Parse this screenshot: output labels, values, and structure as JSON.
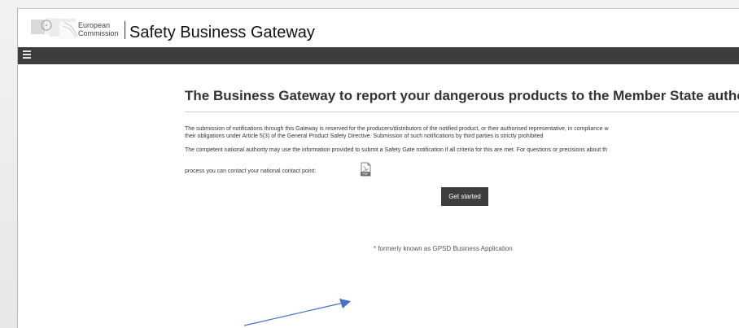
{
  "header": {
    "organization_line1": "European",
    "organization_line2": "Commission",
    "app_title": "Safety Business Gateway"
  },
  "nav": {
    "menu_icon": "hamburger-menu-icon"
  },
  "main": {
    "title": "The Business Gateway to report your dangerous products to the Member State authorities.*",
    "paragraph_1_line_1": "The submission of notifications through this Gateway is reserved for the producers/distributors of the notified product, or their authorised representative, in compliance w",
    "paragraph_1_line_2": "their obligations under Article 5(3) of the General Product Safety Directive. Submission of such notifications by third parties is strictly prohibited",
    "paragraph_2_line_1": "The competent national authority may use the information provided to submit a Safety Gate notification if all criteria for this are met. For questions or precisions about th",
    "contact_text": "process you can contact your national contact point:",
    "pdf_icon": "pdf-document-icon",
    "get_started_label": "Get started",
    "footnote": "* formerly known as GPSD Business Application"
  },
  "colors": {
    "navbar": "#3d3d3d",
    "button": "#3d3d3d",
    "annotation_arrow": "#4472c4",
    "background": "#ffffff"
  }
}
